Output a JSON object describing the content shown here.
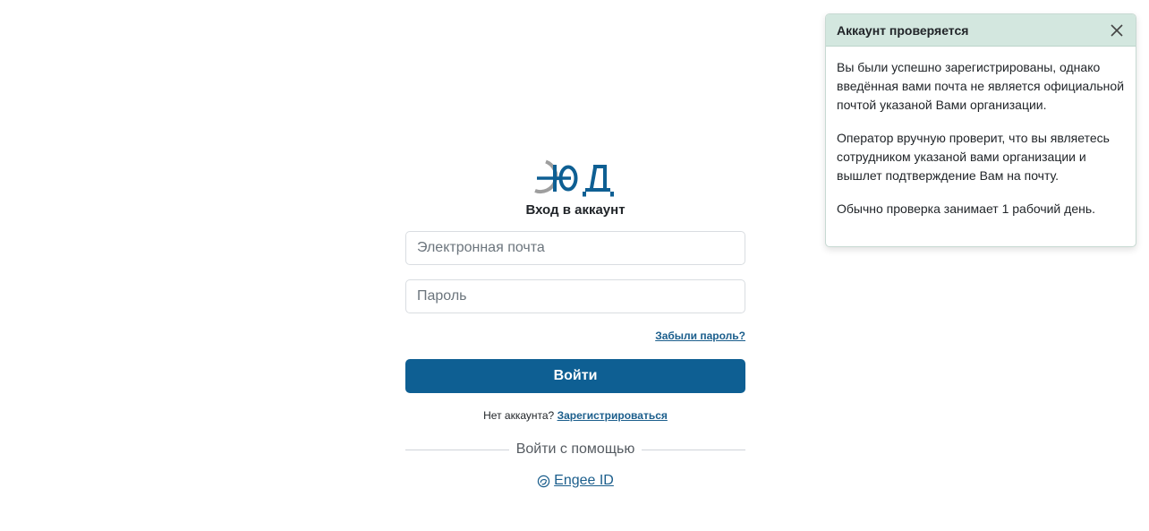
{
  "login": {
    "logo_text": "ЭЮД",
    "title": "Вход в аккаунт",
    "email_placeholder": "Электронная почта",
    "password_placeholder": "Пароль",
    "forgot_link": "Забыли пароль?",
    "submit_label": "Войти",
    "no_account_text": "Нет аккаунта?",
    "register_link": "Зарегистрироваться",
    "divider_text": "Войти с помощью",
    "alt_login_link": " Engee ID"
  },
  "toast": {
    "title": "Аккаунт проверяется",
    "paragraphs": [
      "Вы были успешно зарегистрированы, однако введённая вами почта не является официальной почтой указаной Вами организации.",
      "Оператор вручную проверит, что вы являетесь сотрудником указаной вами организации и вышлет подтверждение Вам на почту.",
      "Обычно проверка занимает 1 рабочий день."
    ]
  },
  "colors": {
    "primary": "#0e5f93",
    "link": "#1b5e8c",
    "toast_header": "#d3e7df",
    "logo_gray": "#9e9e9e",
    "logo_blue": "#0e5f93"
  },
  "icons": {
    "close": "close-icon",
    "engee": "engee-id-icon"
  }
}
